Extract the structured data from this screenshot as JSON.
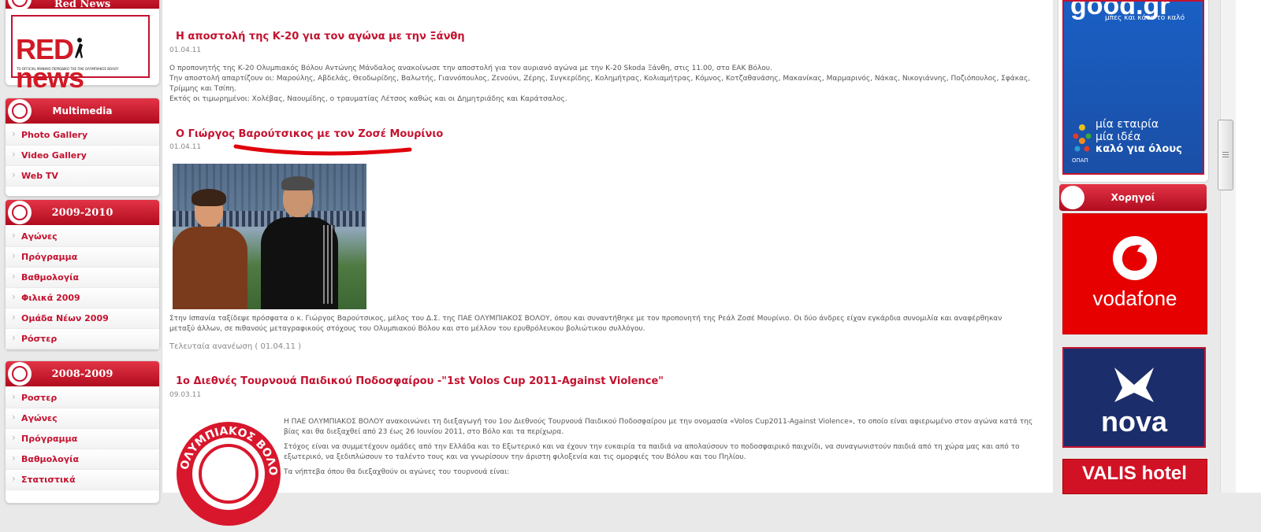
{
  "left": {
    "red_news_header": "Red News",
    "red_news_logo": {
      "big": "RED",
      "tail": "news",
      "tagline": "ΤΟ OFFICIAL ΜΗΝΙΑΙΟ ΠΕΡΙΟΔΙΚΟ ΤΗΣ ΠΑΕ ΟΛΥΜΠΙΑΚΟΣ ΒΟΛΟΥ"
    },
    "multimedia": {
      "title": "Multimedia",
      "items": [
        "Photo Gallery",
        "Video Gallery",
        "Web TV"
      ]
    },
    "season_2009_2010": {
      "title": "2009-2010",
      "items": [
        "Αγώνες",
        "Πρόγραμμα",
        "Βαθμολογία",
        "Φιλικά 2009",
        "Ομάδα Νέων 2009",
        "Ρόστερ"
      ]
    },
    "season_2008_2009": {
      "title": "2008-2009",
      "items": [
        "Ροστερ",
        "Αγώνες",
        "Πρόγραμμα",
        "Βαθμολογία",
        "Στατιστικά"
      ]
    }
  },
  "articles": [
    {
      "title": "Η αποστολή της Κ-20 για τον αγώνα με την Ξάνθη",
      "date": "01.04.11",
      "body": [
        "Ο προπονητής της Κ-20 Ολυμπιακός Βόλου Αντώνης Μάνδαλος ανακοίνωσε την αποστολή για τον αυριανό αγώνα με την Κ-20 Skoda Ξάνθη, στις 11.00, στο ΕΑΚ Βόλου.",
        "Την αποστολή απαρτίζουν οι: Μαρούλης, Αβδελάς, Θεοδωρίδης, Βαλωτής, Γιαννόπουλος, Ζενούνι, Ζέρης, Συγκερίδης, Κολημήτρας, Κολιαμήτρας, Κόμνος, Κοτζαθανάσης, Μακανίκας, Μαρμαρινός, Νάκας, Νικογιάννης, Ποζιόπουλος, Σφάκας, Τρίμμης και Τσίπη.",
        "Εκτός οι τιμωρημένοι: Χολέβας, Ναουμίδης, ο τραυματίας Λέτσος καθώς και οι Δημητριάδης και Καράτσαλος."
      ]
    },
    {
      "title": "Ο Γιώργος Βαρούτσικος με τον Ζοσέ Μουρίνιο",
      "date": "01.04.11",
      "body": [
        "Στην Ισπανία ταξίδεψε πρόσφατα ο κ. Γιώργος Βαρούτσικος, μέλος του Δ.Σ. της ΠΑΕ ΟΛΥΜΠΙΑΚΟΣ ΒΟΛΟΥ, όπου και συναντήθηκε με τον προπονητή της Ρεάλ Ζοσέ Μουρίνιο. Οι δύο άνδρες είχαν εγκάρδια συνομιλία και αναφέρθηκαν μεταξύ άλλων, σε πιθανούς μεταγραφικούς στόχους του Ολυμπιακού Βόλου και στο μέλλον του ερυθρόλευκου βολιώτικου συλλόγου."
      ],
      "updated": "Τελευταία ανανέωση ( 01.04.11 )"
    },
    {
      "title": "1ο Διεθνές Τουρνουά Παιδικού Ποδοσφαίρου -\"1st Volos Cup 2011-Against Violence\"",
      "date": "09.03.11",
      "crest_text": "ΟΛΥΜΠΙΑΚΟΣ ΒΟΛΟΥ",
      "body": [
        "Η ΠΑΕ ΟΛΥΜΠΙΑΚΟΣ ΒΟΛΟΥ ανακοινώνει τη διεξαγωγή του 1ου Διεθνούς Τουρνουά Παιδικού Ποδοσφαίρου με την ονομασία «Volos Cup2011-Against Violence», το οποίο είναι αφιερωμένο στον αγώνα κατά της βίας και θα διεξαχθεί από 23 έως 26 Ιουνίου 2011, στο Βόλο και τα περίχωρα.",
        "Στόχος είναι να συμμετέχουν ομάδες από την Ελλάδα και το Εξωτερικό και να έχουν την ευκαιρία τα παιδιά να απολαύσουν το ποδοσφαιρικό παιχνίδι, να συναγωνιστούν παιδιά από τη χώρα μας και από το εξωτερικό, να ξεδιπλώσουν το ταλέντο τους και να γνωρίσουν την άριστη φιλοξενία και τις ομορφιές του Βόλου και του Πηλίου.",
        "Τα νήπτεβα όπου θα διεξαχθούν οι αγώνες του τουρνουά είναι:"
      ]
    }
  ],
  "right": {
    "opap_ad": {
      "top": "good.gr",
      "slogan": "μπες και κάνε το καλό",
      "line1": "μία εταιρία",
      "line2": "μία ιδέα",
      "line3": "καλό για όλους",
      "brand": "ΟΠΑΠ"
    },
    "sponsors_title": "Χορηγοί",
    "sponsors": [
      "vodafone",
      "nova",
      "VALIS hotel"
    ]
  },
  "colors": {
    "accent": "#c4122f",
    "vodafone": "#e60000",
    "nova": "#1c2d6b",
    "opap": "#1f5cb0"
  }
}
